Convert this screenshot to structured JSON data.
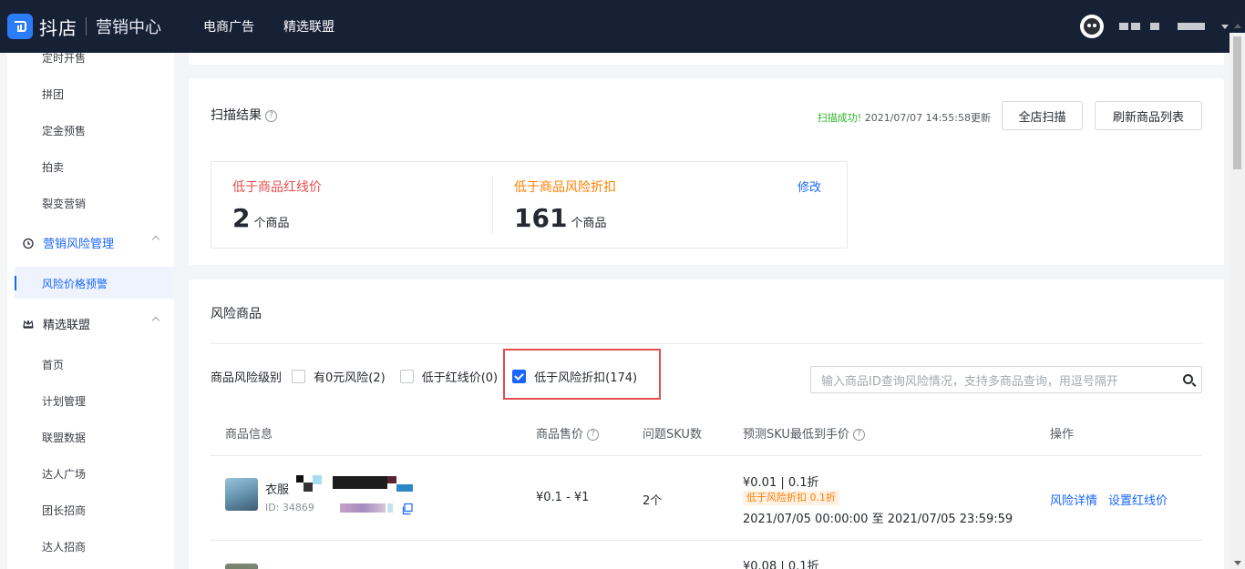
{
  "header": {
    "brand_name": "抖店",
    "brand_sub": "营销中心",
    "nav": [
      "电商广告",
      "精选联盟"
    ]
  },
  "sidebar": {
    "top_items": [
      "定时开售",
      "拼团",
      "定金预售",
      "拍卖",
      "裂变营销"
    ],
    "group_risk": "营销风险管理",
    "active_item": "风险价格预警",
    "group_alliance": "精选联盟",
    "alliance_items": [
      "首页",
      "计划管理",
      "联盟数据",
      "达人广场",
      "团长招商",
      "达人招商"
    ]
  },
  "scan": {
    "title": "扫描结果",
    "status_ok": "扫描成功!",
    "status_time": " 2021/07/07 14:55:58更新",
    "btn_full_scan": "全店扫描",
    "btn_refresh": "刷新商品列表",
    "stat1_label": "低于商品红线价",
    "stat1_num": "2",
    "stat1_unit": "个商品",
    "stat2_label": "低于商品风险折扣",
    "stat2_num": "161",
    "stat2_unit": "个商品",
    "edit": "修改"
  },
  "risk": {
    "title": "风险商品",
    "filter_label": "商品风险级别",
    "filters": [
      {
        "label": "有0元风险(2)",
        "checked": false
      },
      {
        "label": "低于红线价(0)",
        "checked": false
      },
      {
        "label": "低于风险折扣(174)",
        "checked": true
      }
    ],
    "search_placeholder": "输入商品ID查询风险情况，支持多商品查询，用逗号隔开",
    "columns": [
      "商品信息",
      "商品售价",
      "问题SKU数",
      "预测SKU最低到手价",
      "操作"
    ],
    "rows": [
      {
        "name": "衣服",
        "id": "ID: 34869",
        "price": "¥0.1 - ¥1",
        "sku_count": "2个",
        "lowest": "¥0.01 | 0.1折",
        "tag": "低于风险折扣 0.1折",
        "period": "2021/07/05 00:00:00 至 2021/07/05 23:59:59",
        "action1": "风险详情",
        "action2": "设置红线价"
      },
      {
        "lowest": "¥0.08 | 0.1折"
      }
    ]
  },
  "colors": {
    "topbar": "#172136",
    "accent": "#1966ff",
    "red": "#e34d4d",
    "orange": "#ff8000",
    "success": "#2cb52a"
  }
}
